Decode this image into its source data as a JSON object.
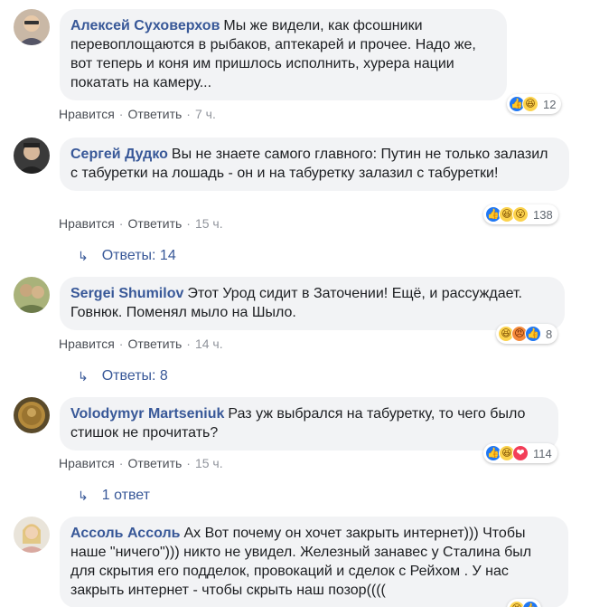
{
  "labels": {
    "like": "Нравится",
    "reply": "Ответить",
    "sep": "·"
  },
  "comments": [
    {
      "author": "Алексей Суховерхов",
      "text": "Мы же видели, как фсошники перевоплощаются в рыбаков, аптекарей и прочее. Надо же, вот теперь и коня им пришлось исполнить, хурера нации покатать на камеру...",
      "time": "7 ч.",
      "reaction_icons": [
        "like-icon",
        "haha-icon"
      ],
      "reaction_count": "12"
    },
    {
      "author": "Сергей Дудко",
      "text": "Вы не знаете самого главного: Путин не только залазил с табуретки на лошадь - он и на табуретку залазил с табуретки!",
      "time": "15 ч.",
      "reaction_icons": [
        "like-icon",
        "haha-icon",
        "wow-icon"
      ],
      "reaction_count": "138",
      "replies": "Ответы: 14"
    },
    {
      "author": "Sergei Shumilov",
      "text": "Этот Урод сидит в Заточении! Ещё, и рассуждает. Говнюк. Поменял мыло на Шыло.",
      "time": "14 ч.",
      "reaction_icons": [
        "haha-icon",
        "angry-icon",
        "like-icon"
      ],
      "reaction_count": "8",
      "replies": "Ответы: 8"
    },
    {
      "author": "Volodymyr Martseniuk",
      "text": "Раз уж выбрался на табуретку, то чего было стишок не прочитать?",
      "time": "15 ч.",
      "reaction_icons": [
        "like-icon",
        "haha-icon",
        "love-icon"
      ],
      "reaction_count": "114",
      "replies": "1 ответ"
    },
    {
      "author": "Ассоль Ассоль",
      "text": "Ах Вот почему он хочет закрыть интернет))) Чтобы наше \"ничего\"))) никто не увидел. Железный занавес у Сталина был для скрытия его подделок, провокаций и сделок с Рейхом . У нас закрыть интернет - чтобы скрыть наш позор((((",
      "reaction_icons": [
        "haha-icon",
        "like-icon"
      ]
    }
  ]
}
